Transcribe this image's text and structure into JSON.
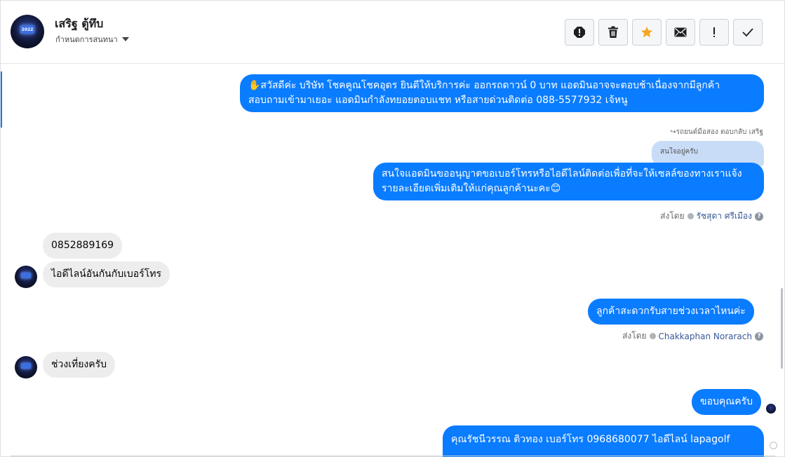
{
  "header": {
    "contact_name": "เสริฐ ตู้ทึบ",
    "conversation_settings": "กำหนดการสนทนา",
    "avatar_label": "2022"
  },
  "toolbar": {
    "buttons": [
      {
        "name": "report-icon",
        "title": "report"
      },
      {
        "name": "trash-icon",
        "title": "delete"
      },
      {
        "name": "star-icon",
        "title": "star"
      },
      {
        "name": "mail-icon",
        "title": "mark unread"
      },
      {
        "name": "exclamation-icon",
        "title": "important"
      },
      {
        "name": "check-icon",
        "title": "done"
      }
    ],
    "star_color": "#f5a623"
  },
  "colors": {
    "outgoing_bubble": "#0a7cff",
    "incoming_bubble": "#ededed",
    "agent_name": "#385898"
  },
  "messages": {
    "m1": "✋สวัสดีค่ะ บริษัท โชคคูณโชคอุดร ยินดีให้บริการค่ะ ออกรถดาวน์ 0 บาท แอดมินอาจจะตอบช้าเนื่องจากมีลูกค้าสอบถามเข้ามาเยอะ แอดมินกำลังทยอยตอบแชท หรือสายด่วนติดต่อ 088-5577932 เจ้หนู",
    "m2_reply_ref": "↪รถยนต์มือสอง ตอบกลับ เสริฐ",
    "m2_quoted": "สนใจอยู่ครับ",
    "m2": "สนใจแอดมินขออนุญาตขอเบอร์โทรหรือไอดีไลน์ติดต่อเพื่อที่จะให้เซลล์ของทางเราแจ้งรายละเอียดเพิ่มเติมให้แก่คุณลูกค้านะคะ😊",
    "m2_sent_by_prefix": "ส่งโดย",
    "m2_sent_by": "รัชสุดา ศรีเมือง",
    "m3": "0852889169",
    "m4": "ไอดีไลน์อันกันกับเบอร์โทร",
    "m5": "ลูกค้าสะดวกรับสายช่วงเวลาไหนค่ะ",
    "m5_sent_by_prefix": "ส่งโดย",
    "m5_sent_by": "Chakkaphan Norarach",
    "m6": "ช่วงเที่ยงครับ",
    "m7": "ขอบคุณครับ",
    "m8": "คุณรัชนีวรรณ ติวทอง      เบอร์โทร 0968680077  ไอดีไลน์ lapagolf"
  }
}
